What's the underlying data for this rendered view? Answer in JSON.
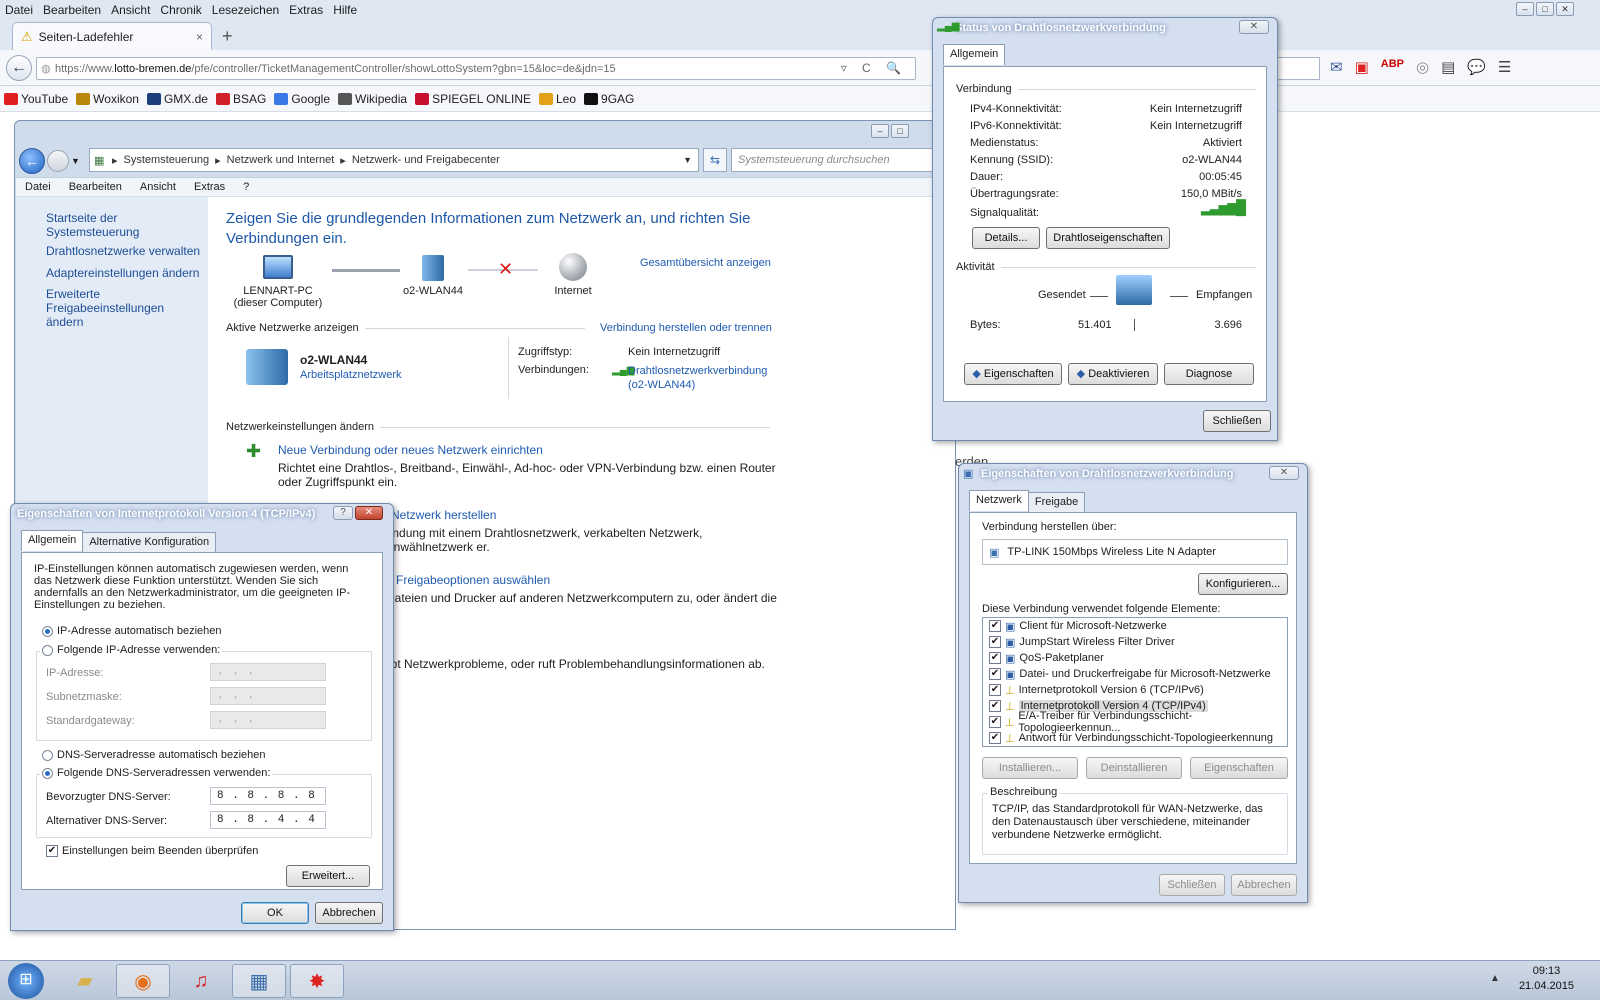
{
  "firefox": {
    "menu": [
      "Datei",
      "Bearbeiten",
      "Ansicht",
      "Chronik",
      "Lesezeichen",
      "Extras",
      "Hilfe"
    ],
    "tab_title": "Seiten-Ladefehler",
    "url_prefix": "https://www.",
    "url_host": "lotto-bremen.de",
    "url_path": "/pfe/controller/TicketManagementController/showLottoSystem?gbn=15&loc=de&jdn=15",
    "bookmarks": [
      {
        "label": "YouTube",
        "color": "#e02020"
      },
      {
        "label": "Woxikon",
        "color": "#b8860b"
      },
      {
        "label": "GMX.de",
        "color": "#1c3f7c"
      },
      {
        "label": "BSAG",
        "color": "#d0202a"
      },
      {
        "label": "Google",
        "color": "#3b78e7"
      },
      {
        "label": "Wikipedia",
        "color": "#555555"
      },
      {
        "label": "SPIEGEL ONLINE",
        "color": "#c8102e"
      },
      {
        "label": "Leo",
        "color": "#e3a21a"
      },
      {
        "label": "9GAG",
        "color": "#111111"
      }
    ]
  },
  "control_panel": {
    "breadcrumb": [
      "Systemsteuerung",
      "Netzwerk und Internet",
      "Netzwerk- und Freigabecenter"
    ],
    "search_placeholder": "Systemsteuerung durchsuchen",
    "menu": [
      "Datei",
      "Bearbeiten",
      "Ansicht",
      "Extras",
      "?"
    ],
    "left_links": [
      "Startseite der Systemsteuerung",
      "Drahtlosnetzwerke verwalten",
      "Adaptereinstellungen ändern",
      "Erweiterte Freigabeeinstellungen ändern"
    ],
    "heading": "Zeigen Sie die grundlegenden Informationen zum Netzwerk an, und richten Sie Verbindungen ein.",
    "overview_link": "Gesamtübersicht anzeigen",
    "nodes": [
      {
        "label": "LENNART-PC",
        "sub": "(dieser Computer)"
      },
      {
        "label": "o2-WLAN44",
        "sub": ""
      },
      {
        "label": "Internet",
        "sub": ""
      }
    ],
    "active_networks_label": "Aktive Netzwerke anzeigen",
    "connect_link": "Verbindung herstellen oder trennen",
    "network_name": "o2-WLAN44",
    "network_type": "Arbeitsplatznetzwerk",
    "access_type_label": "Zugriffstyp:",
    "access_type_value": "Kein Internetzugriff",
    "connections_label": "Verbindungen:",
    "connections_value": "Drahtlosnetzwerkverbindung (o2-WLAN44)",
    "change_settings_label": "Netzwerkeinstellungen ändern",
    "tasks": [
      {
        "title": "Neue Verbindung oder neues Netzwerk einrichten",
        "desc": "Richtet eine Drahtlos-, Breitband-, Einwähl-, Ad-hoc- oder VPN-Verbindung bzw. einen Router oder Zugriffspunkt ein."
      },
      {
        "title": "Netzwerk herstellen",
        "desc": "bindung mit einem Drahtlosnetzwerk, verkabelten Netzwerk, Einwählnetzwerk er."
      },
      {
        "title": "d Freigabeoptionen auswählen",
        "desc": "Dateien und Drucker auf anderen Netzwerkcomputern zu, oder ändert die"
      },
      {
        "title": "",
        "desc": "ebt Netzwerkprobleme, oder ruft Problembehandlungsinformationen ab."
      }
    ]
  },
  "status_dialog": {
    "title": "Status von Drahtlosnetzwerkverbindung",
    "tab": "Allgemein",
    "connection_label": "Verbindung",
    "rows": [
      {
        "k": "IPv4-Konnektivität:",
        "v": "Kein Internetzugriff"
      },
      {
        "k": "IPv6-Konnektivität:",
        "v": "Kein Internetzugriff"
      },
      {
        "k": "Medienstatus:",
        "v": "Aktiviert"
      },
      {
        "k": "Kennung (SSID):",
        "v": "o2-WLAN44"
      },
      {
        "k": "Dauer:",
        "v": "00:05:45"
      },
      {
        "k": "Übertragungsrate:",
        "v": "150,0 MBit/s"
      }
    ],
    "signal_label": "Signalqualität:",
    "details_btn": "Details...",
    "wireless_props_btn": "Drahtloseigenschaften",
    "activity_label": "Aktivität",
    "sent_label": "Gesendet",
    "received_label": "Empfangen",
    "bytes_label": "Bytes:",
    "bytes_sent": "51.401",
    "bytes_received": "3.696",
    "props_btn": "Eigenschaften",
    "disable_btn": "Deaktivieren",
    "diagnose_btn": "Diagnose",
    "close_btn": "Schließen"
  },
  "props_dialog": {
    "title": "Eigenschaften von Drahtlosnetzwerkverbindung",
    "tabs": [
      "Netzwerk",
      "Freigabe"
    ],
    "connect_via_label": "Verbindung herstellen über:",
    "adapter": "TP-LINK 150Mbps Wireless Lite N Adapter",
    "configure_btn": "Konfigurieren...",
    "items_label": "Diese Verbindung verwendet folgende Elemente:",
    "items": [
      "Client für Microsoft-Netzwerke",
      "JumpStart Wireless Filter Driver",
      "QoS-Paketplaner",
      "Datei- und Druckerfreigabe für Microsoft-Netzwerke",
      "Internetprotokoll Version 6 (TCP/IPv6)",
      "Internetprotokoll Version 4 (TCP/IPv4)",
      "E/A-Treiber für Verbindungsschicht-Topologieerkennun...",
      "Antwort für Verbindungsschicht-Topologieerkennung"
    ],
    "install_btn": "Installieren...",
    "uninstall_btn": "Deinstallieren",
    "properties_btn": "Eigenschaften",
    "description_label": "Beschreibung",
    "description": "TCP/IP, das Standardprotokoll für WAN-Netzwerke, das den Datenaustausch über verschiedene, miteinander verbundene Netzwerke ermöglicht.",
    "close_btn": "Schließen",
    "cancel_btn": "Abbrechen"
  },
  "ipv4_dialog": {
    "title": "Eigenschaften von Internetprotokoll Version 4 (TCP/IPv4)",
    "tabs": [
      "Allgemein",
      "Alternative Konfiguration"
    ],
    "intro": "IP-Einstellungen können automatisch zugewiesen werden, wenn das Netzwerk diese Funktion unterstützt. Wenden Sie sich andernfalls an den Netzwerkadministrator, um die geeigneten IP-Einstellungen zu beziehen.",
    "ip_auto": "IP-Adresse automatisch beziehen",
    "ip_manual": "Folgende IP-Adresse verwenden:",
    "ip_label": "IP-Adresse:",
    "mask_label": "Subnetzmaske:",
    "gateway_label": "Standardgateway:",
    "dns_auto": "DNS-Serveradresse automatisch beziehen",
    "dns_manual": "Folgende DNS-Serveradressen verwenden:",
    "dns_pref_label": "Bevorzugter DNS-Server:",
    "dns_alt_label": "Alternativer DNS-Server:",
    "dns_pref": "8 . 8 . 8 . 8",
    "dns_alt": "8 . 8 . 4 . 4",
    "empty_ip": ". . .",
    "validate": "Einstellungen beim Beenden überprüfen",
    "advanced_btn": "Erweitert...",
    "ok_btn": "OK",
    "cancel_btn": "Abbrechen"
  },
  "taskbar": {
    "time": "09:13",
    "date": "21.04.2015"
  },
  "stray_text": "erden"
}
